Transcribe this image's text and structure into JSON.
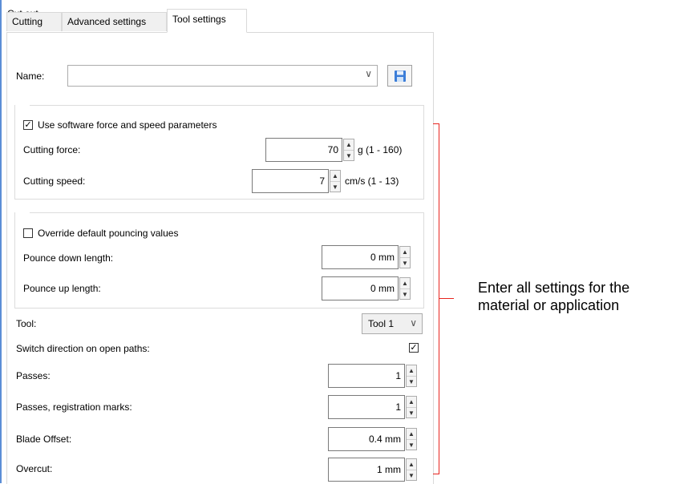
{
  "window": {
    "title": "Cut out"
  },
  "tabs": [
    {
      "label": "Cutting"
    },
    {
      "label": "Advanced settings"
    },
    {
      "label": "Tool settings"
    }
  ],
  "name_row": {
    "label": "Name:",
    "value": ""
  },
  "software_params": {
    "checkbox_label": "Use software force and speed parameters",
    "checked": true,
    "force": {
      "label": "Cutting force:",
      "value": "70",
      "unit": "g (1 - 160)"
    },
    "speed": {
      "label": "Cutting speed:",
      "value": "7",
      "unit": "cm/s (1 - 13)"
    }
  },
  "pouncing": {
    "checkbox_label": "Override default pouncing values",
    "checked": false,
    "down": {
      "label": "Pounce down length:",
      "value": "0 mm"
    },
    "up": {
      "label": "Pounce up length:",
      "value": "0 mm"
    }
  },
  "tool": {
    "label": "Tool:",
    "value": "Tool 1"
  },
  "switch_direction": {
    "label": "Switch direction on open paths:",
    "checked": true
  },
  "passes": {
    "label": "Passes:",
    "value": "1"
  },
  "passes_reg": {
    "label": "Passes, registration marks:",
    "value": "1"
  },
  "blade_offset": {
    "label": "Blade Offset:",
    "value": "0.4 mm"
  },
  "overcut": {
    "label": "Overcut:",
    "value": "1 mm"
  },
  "annotation": {
    "line1": "Enter all settings for the",
    "line2": "material or application"
  }
}
